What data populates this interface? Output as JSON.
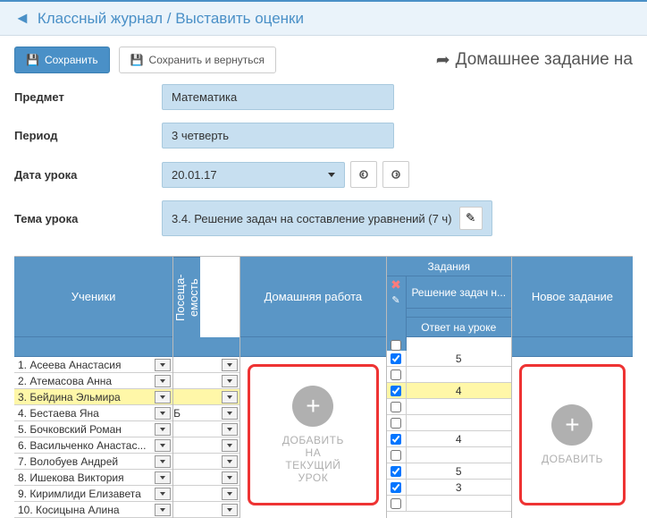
{
  "breadcrumb": "Классный журнал / Выставить оценки",
  "toolbar": {
    "save": "Сохранить",
    "save_back": "Сохранить и вернуться",
    "homework_heading": "Домашнее задание на"
  },
  "form": {
    "subject_label": "Предмет",
    "subject_value": "Математика",
    "period_label": "Период",
    "period_value": "3 четверть",
    "date_label": "Дата урока",
    "date_value": "20.01.17",
    "topic_label": "Тема урока",
    "topic_value": "3.4. Решение задач на составление уравнений (7 ч)"
  },
  "headers": {
    "students": "Ученики",
    "attendance": "Посеща-емость",
    "homework": "Домашняя работа",
    "tasks": "Задания",
    "task_name": "Решение задач н...",
    "answer": "Ответ на уроке",
    "new_task": "Новое задание"
  },
  "add_button_hw": "ДОБАВИТЬ\nНА\nТЕКУЩИЙ\nУРОК",
  "add_button_new": "ДОБАВИТЬ",
  "students": [
    {
      "n": "1",
      "name": "Асеева Анастасия",
      "att": "",
      "chk": true,
      "grade": "5",
      "hl": false
    },
    {
      "n": "2",
      "name": "Атемасова Анна",
      "att": "",
      "chk": false,
      "grade": "",
      "hl": false
    },
    {
      "n": "3",
      "name": "Бейдина Эльмира",
      "att": "",
      "chk": true,
      "grade": "4",
      "hl": true
    },
    {
      "n": "4",
      "name": "Бестаева Яна",
      "att": "Б",
      "chk": false,
      "grade": "",
      "hl": false
    },
    {
      "n": "5",
      "name": "Бочковский Роман",
      "att": "",
      "chk": false,
      "grade": "",
      "hl": false
    },
    {
      "n": "6",
      "name": "Васильченко Анастас...",
      "att": "",
      "chk": true,
      "grade": "4",
      "hl": false
    },
    {
      "n": "7",
      "name": "Волобуев Андрей",
      "att": "",
      "chk": false,
      "grade": "",
      "hl": false
    },
    {
      "n": "8",
      "name": "Ишекова Виктория",
      "att": "",
      "chk": true,
      "grade": "5",
      "hl": false
    },
    {
      "n": "9",
      "name": "Киримлиди Елизавета",
      "att": "",
      "chk": true,
      "grade": "3",
      "hl": false
    },
    {
      "n": "10",
      "name": "Косицына Алина",
      "att": "",
      "chk": false,
      "grade": "",
      "hl": false
    }
  ]
}
